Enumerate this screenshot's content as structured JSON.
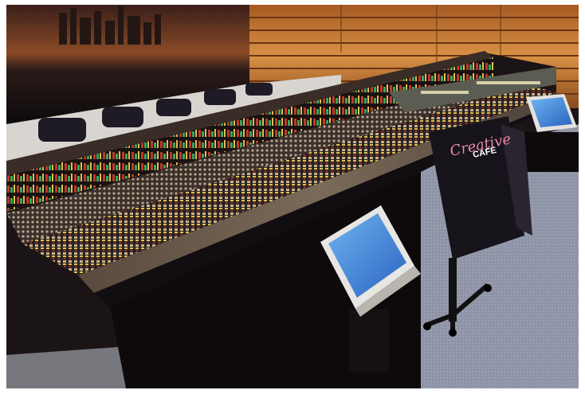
{
  "photo": {
    "chair_logo_script": "Creative",
    "chair_logo_word": "CAFE"
  },
  "colors": {
    "wall_wood": "#c8803a",
    "console_body": "#1b1416",
    "carpet": "#8e94a6",
    "screen_blue": "#3b7bd2",
    "meter_red": "#c0392b",
    "meter_green": "#3aa55c"
  },
  "icons": {
    "chair": "office-chair-icon",
    "monitor": "monitor-icon"
  }
}
